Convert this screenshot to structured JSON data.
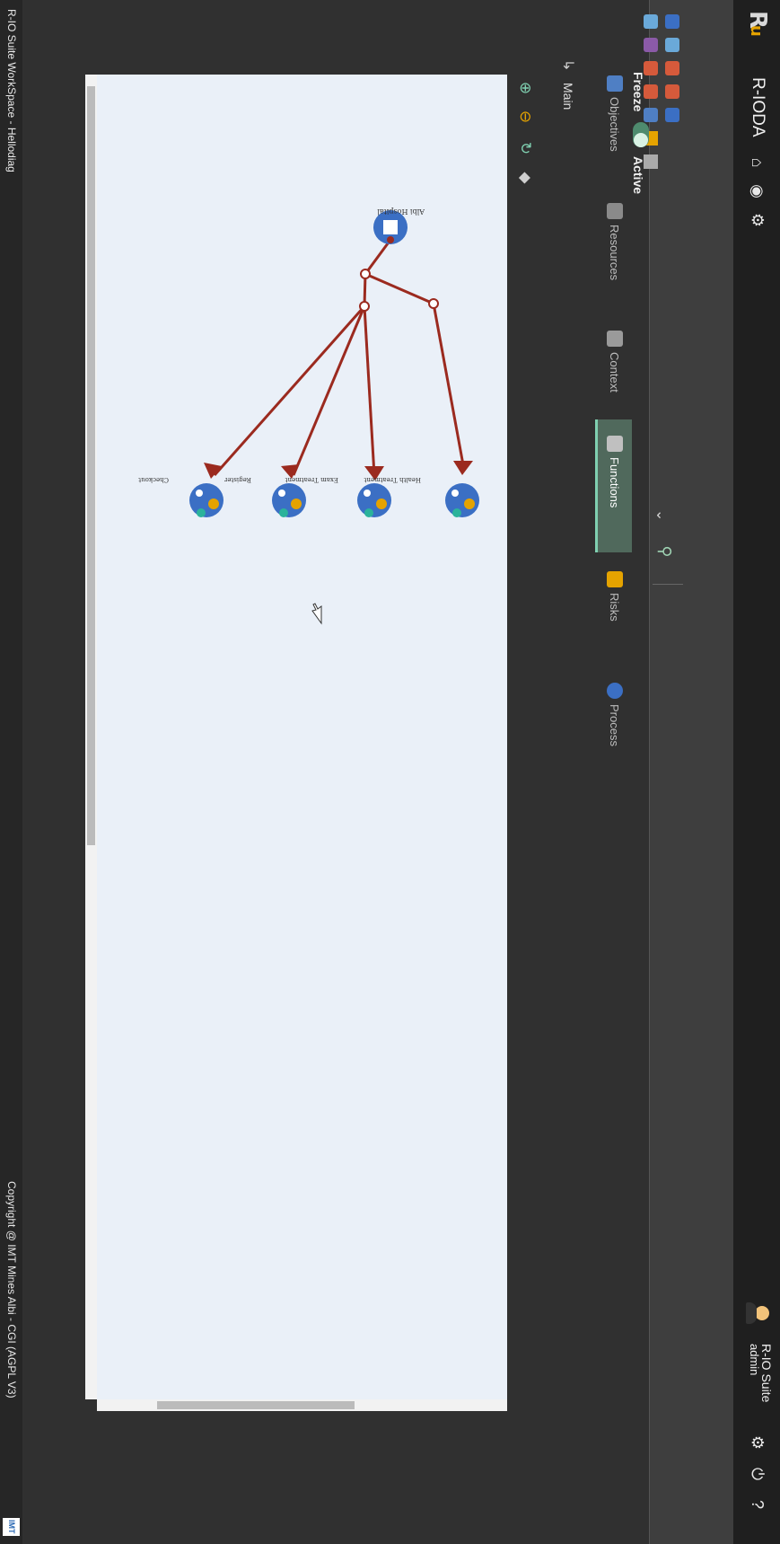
{
  "header": {
    "app_name": "R-IODA",
    "user_name": "R-IO Suite",
    "user_role": "admin"
  },
  "toolbar": {
    "freeze_label": "Freeze",
    "active_label": "Active",
    "freeze_on": true
  },
  "tabs": [
    {
      "label": "Objectives"
    },
    {
      "label": "Resources"
    },
    {
      "label": "Context"
    },
    {
      "label": "Functions"
    },
    {
      "label": "Risks"
    },
    {
      "label": "Process"
    }
  ],
  "active_tab": "Functions",
  "breadcrumb": {
    "main": "Main"
  },
  "diagram": {
    "root": "Albi Hospital",
    "functions": [
      "Health Treatment",
      "Exam Treatment",
      "Register",
      "Checkout"
    ]
  },
  "footer": {
    "title": "R-IO Suite WorkSpace - Hellodiag",
    "copyright": "Copyright @ IMT Mines Albi - CGI (AGPL V3)"
  },
  "colors": {
    "accent": "#4e8b6e",
    "edge": "#9b2a1f",
    "node_fill": "#3b6fc4",
    "canvas_bg": "#eaf0f8"
  }
}
